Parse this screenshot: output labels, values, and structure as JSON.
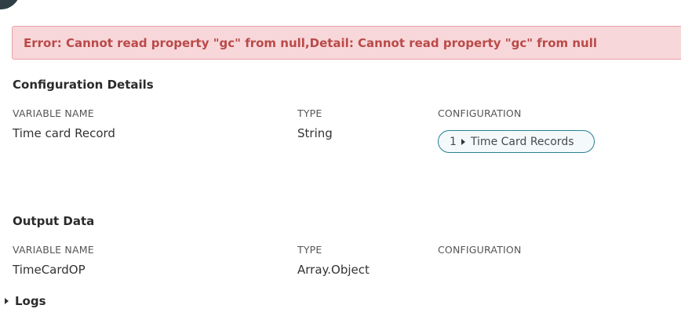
{
  "error": {
    "message": "Error: Cannot read property \"gc\" from null,Detail: Cannot read property \"gc\" from null"
  },
  "configuration_details": {
    "title": "Configuration Details",
    "headers": {
      "variable_name": "VARIABLE NAME",
      "type": "TYPE",
      "configuration": "CONFIGURATION"
    },
    "row": {
      "variable_name": "Time card Record",
      "type": "String",
      "config_count": "1",
      "config_label": "Time Card Records"
    }
  },
  "output_data": {
    "title": "Output Data",
    "headers": {
      "variable_name": "VARIABLE NAME",
      "type": "TYPE",
      "configuration": "CONFIGURATION"
    },
    "row": {
      "variable_name": "TimeCardOP",
      "type": "Array.Object"
    }
  },
  "logs": {
    "label": "Logs"
  },
  "colors": {
    "error_bg": "#f8d7da",
    "error_text": "#b94a48",
    "accent": "#2a7e93"
  }
}
